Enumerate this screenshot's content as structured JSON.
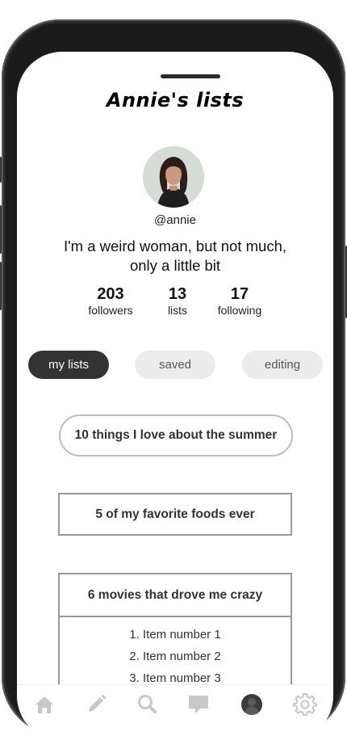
{
  "profile": {
    "title": "Annie's lists",
    "handle": "@annie",
    "bio": "I'm a weird  woman, but not much, only a little bit"
  },
  "stats": [
    {
      "value": "203",
      "label": "followers"
    },
    {
      "value": "13",
      "label": "lists"
    },
    {
      "value": "17",
      "label": "following"
    }
  ],
  "tabs": [
    {
      "label": "my lists",
      "active": true
    },
    {
      "label": "saved",
      "active": false
    },
    {
      "label": "editing",
      "active": false
    }
  ],
  "lists": [
    {
      "title": "10 things I love about the summer"
    },
    {
      "title": "5 of my favorite foods ever"
    },
    {
      "title": "6 movies that drove me crazy",
      "items": [
        "1. Item number 1",
        "2. Item number 2",
        "3. Item number 3"
      ]
    }
  ],
  "nav": {
    "items": [
      "home-icon",
      "pencil-icon",
      "search-icon",
      "chat-icon",
      "profile-icon",
      "gear-icon"
    ],
    "active": "profile-icon",
    "colors": {
      "inactive": "#c8c8c8",
      "active": "#3a3a3a"
    }
  }
}
